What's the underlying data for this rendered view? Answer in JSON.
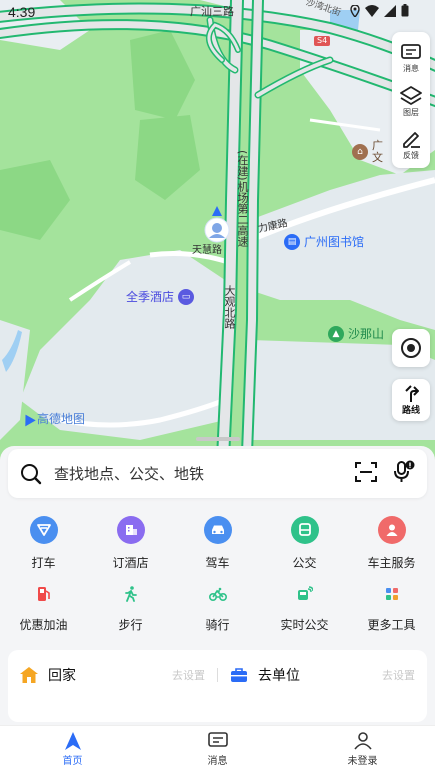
{
  "status": {
    "time": "4:39"
  },
  "map": {
    "labels": {
      "road_guangshan": "广汕三路",
      "road_top_right": "沙湾北街",
      "road_badge": "S4",
      "airport_expressway": "(在建)机场第二高速",
      "tianhui": "天慧路",
      "lidu": "力康路",
      "daguan": "大观北路",
      "culture": "广州文化馆",
      "culture_short": "广\n文",
      "culture_right": "丰\n馆"
    },
    "pois": {
      "library": "广州图书馆",
      "hotel": "全季酒店",
      "mountain": "沙那山"
    },
    "watermark": "高德地图"
  },
  "side_panel": {
    "messages": "消息",
    "layers": "图层",
    "feedback": "反馈"
  },
  "route_label": "路线",
  "search": {
    "placeholder": "查找地点、公交、地铁"
  },
  "services": {
    "row1": [
      {
        "label": "打车",
        "icon": "taxi-icon",
        "color": "#4a8ff0"
      },
      {
        "label": "订酒店",
        "icon": "hotel-icon",
        "color": "#8a6cf0"
      },
      {
        "label": "驾车",
        "icon": "car-icon",
        "color": "#4a8ff0"
      },
      {
        "label": "公交",
        "icon": "bus-icon",
        "color": "#2fc28a"
      },
      {
        "label": "车主服务",
        "icon": "owner-service-icon",
        "color": "#f06a6a"
      }
    ],
    "row2": [
      {
        "label": "优惠加油",
        "icon": "fuel-icon",
        "color": "#f04a4a"
      },
      {
        "label": "步行",
        "icon": "walk-icon",
        "color": "#2fc28a"
      },
      {
        "label": "骑行",
        "icon": "bike-icon",
        "color": "#2fc28a"
      },
      {
        "label": "实时公交",
        "icon": "realtime-bus-icon",
        "color": "#2fc28a"
      },
      {
        "label": "更多工具",
        "icon": "more-tools-icon",
        "color": "#f0a030"
      }
    ]
  },
  "places": {
    "home": {
      "label": "回家",
      "action": "去设置"
    },
    "work": {
      "label": "去单位",
      "action": "去设置"
    }
  },
  "tabs": [
    {
      "label": "首页",
      "active": true
    },
    {
      "label": "消息",
      "active": false
    },
    {
      "label": "未登录",
      "active": false
    }
  ]
}
